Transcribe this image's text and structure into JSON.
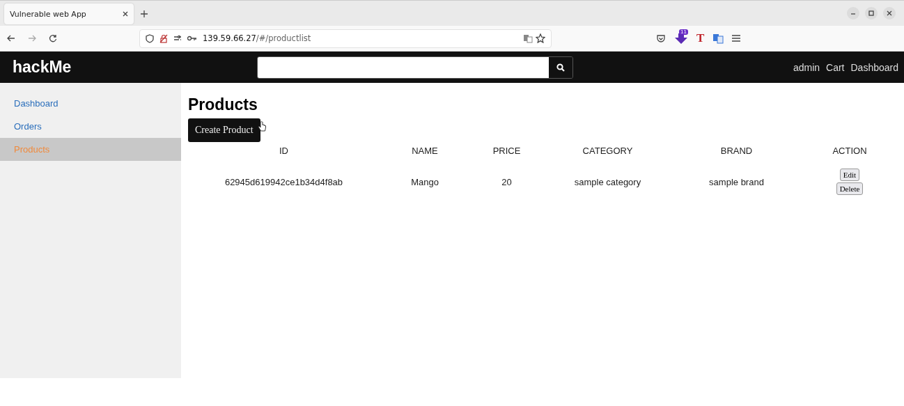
{
  "browser": {
    "tabs": [
      {
        "title": "Vulnerable web App",
        "selected": true
      }
    ],
    "url_host": "139.59.66.27",
    "url_path": "/#/productlist",
    "extension_badge": "11",
    "extension_letter": "T"
  },
  "navbar": {
    "brand": "hackMe",
    "links": [
      "admin",
      "Cart",
      "Dashboard"
    ]
  },
  "sidebar": {
    "items": [
      {
        "label": "Dashboard",
        "selected": false
      },
      {
        "label": "Orders",
        "selected": false
      },
      {
        "label": "Products",
        "selected": true
      }
    ]
  },
  "page": {
    "title": "Products",
    "create_button": "Create Product"
  },
  "table": {
    "columns": [
      "ID",
      "NAME",
      "PRICE",
      "CATEGORY",
      "BRAND",
      "ACTION"
    ],
    "rows": [
      {
        "cells": [
          "62945d619942ce1b34d4f8ab",
          "Mango",
          "20",
          "sample category",
          "sample brand"
        ],
        "actions": [
          "Edit",
          "Delete"
        ]
      }
    ]
  }
}
